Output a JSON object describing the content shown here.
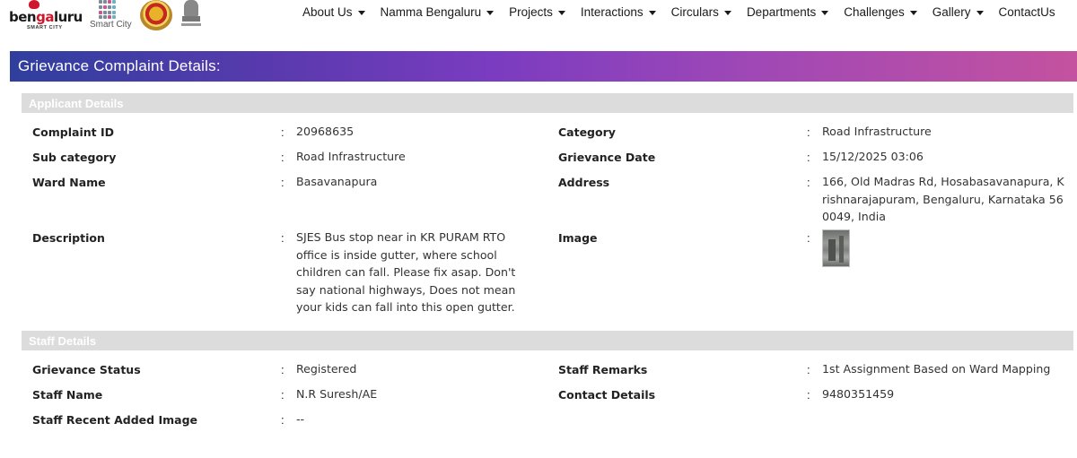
{
  "logos": {
    "bengaluru_word_a": "ben",
    "bengaluru_word_b": "ga",
    "bengaluru_word_c": "luru",
    "bengaluru_tag": "SMART CITY",
    "smartcity_text": "Smart City"
  },
  "nav": {
    "items": [
      "About Us",
      "Namma Bengaluru",
      "Projects",
      "Interactions",
      "Circulars",
      "Departments",
      "Challenges",
      "Gallery"
    ],
    "last": "ContactUs"
  },
  "page": {
    "title": "Grievance Complaint Details:"
  },
  "applicant": {
    "heading": "Applicant Details",
    "complaint_id_label": "Complaint ID",
    "complaint_id": "20968635",
    "category_label": "Category",
    "category": "Road Infrastructure",
    "subcategory_label": "Sub category",
    "subcategory": "Road Infrastructure",
    "date_label": "Grievance Date",
    "date": "15/12/2025 03:06",
    "ward_label": "Ward Name",
    "ward": "Basavanapura",
    "address_label": "Address",
    "address": "166, Old Madras Rd, Hosabasavanapura, Krishnarajapuram, Bengaluru, Karnataka 560049, India",
    "description_label": "Description",
    "description": "SJES Bus stop near in KR PURAM RTO office is inside gutter, where school children can fall. Please fix asap. Don't say national highways, Does not mean your kids can fall into this open gutter.",
    "image_label": "Image"
  },
  "staff": {
    "heading": "Staff Details",
    "status_label": "Grievance Status",
    "status": "Registered",
    "remarks_label": "Staff Remarks",
    "remarks": "1st Assignment Based on Ward Mapping",
    "name_label": "Staff Name",
    "name": "N.R Suresh/AE",
    "contact_label": "Contact Details",
    "contact": "9480351459",
    "recent_image_label": "Staff Recent Added Image",
    "recent_image": "--"
  },
  "separator": ":",
  "colors": {
    "band_start": "#2f3f9e",
    "band_end": "#c4529f",
    "section_bg": "#dcdcdc"
  }
}
